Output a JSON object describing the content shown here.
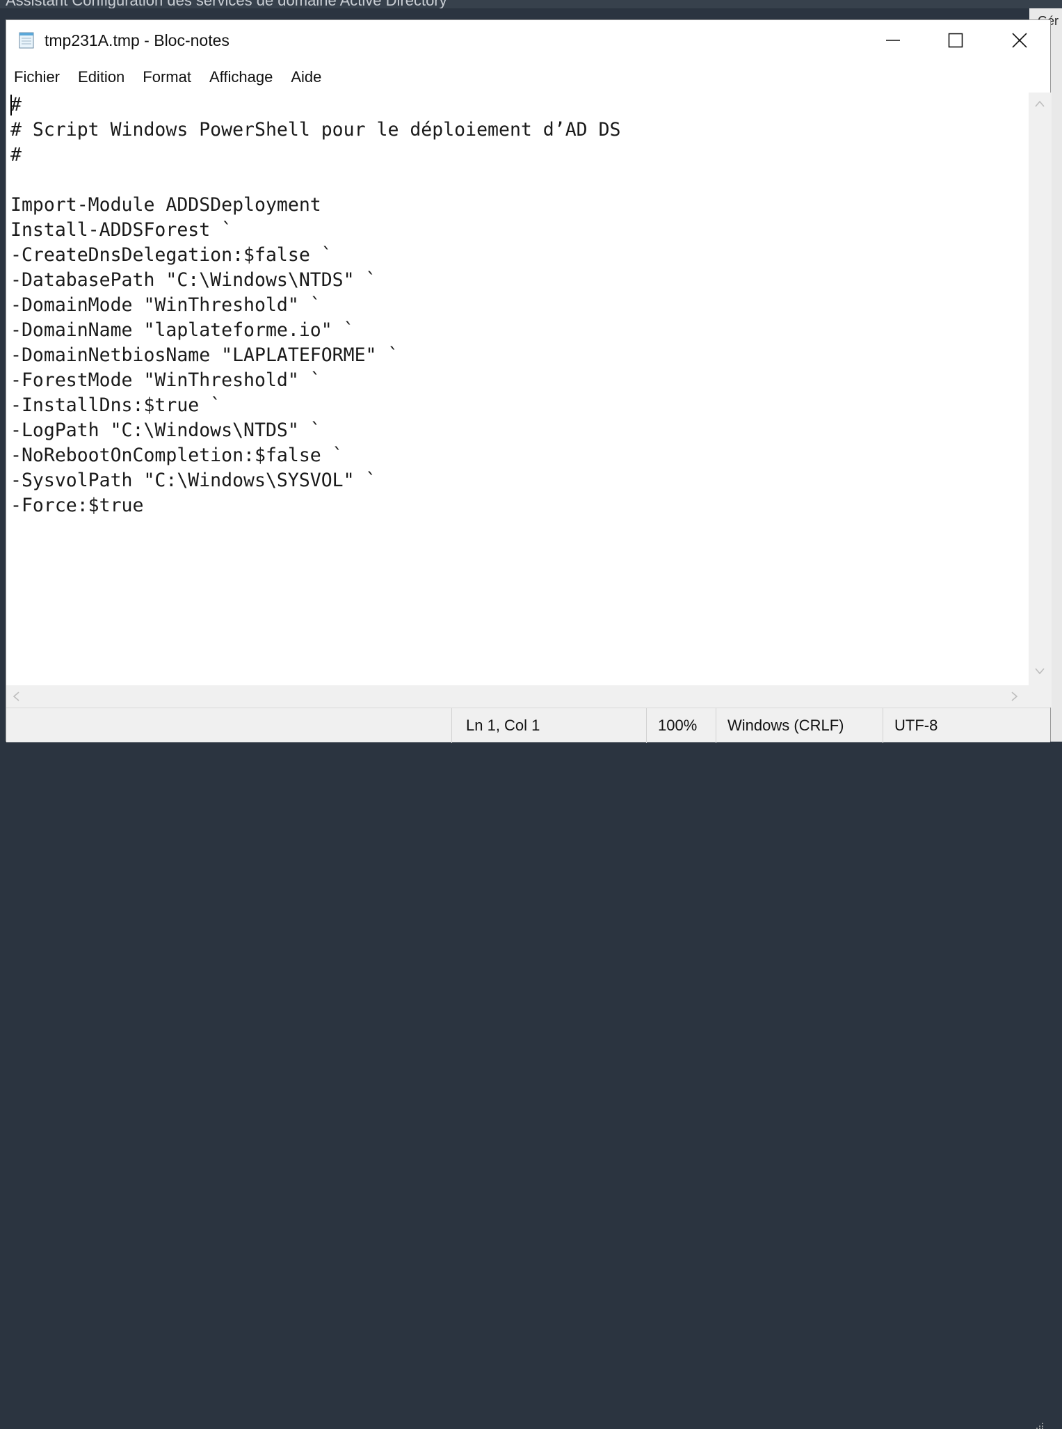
{
  "background": {
    "title": "Assistant Configuration des services de domaine Active Directory",
    "peek_text": "Gér"
  },
  "window": {
    "title": "tmp231A.tmp - Bloc-notes",
    "icon": "notepad-icon",
    "controls": {
      "minimize": "minimize-icon",
      "maximize": "maximize-icon",
      "close": "close-icon"
    }
  },
  "menu": {
    "items": [
      {
        "label": "Fichier"
      },
      {
        "label": "Edition"
      },
      {
        "label": "Format"
      },
      {
        "label": "Affichage"
      },
      {
        "label": "Aide"
      }
    ]
  },
  "editor": {
    "lines": [
      "#",
      "# Script Windows PowerShell pour le déploiement d’AD DS",
      "#",
      "",
      "Import-Module ADDSDeployment",
      "Install-ADDSForest `",
      "-CreateDnsDelegation:$false `",
      "-DatabasePath \"C:\\Windows\\NTDS\" `",
      "-DomainMode \"WinThreshold\" `",
      "-DomainName \"laplateforme.io\" `",
      "-DomainNetbiosName \"LAPLATEFORME\" `",
      "-ForestMode \"WinThreshold\" `",
      "-InstallDns:$true `",
      "-LogPath \"C:\\Windows\\NTDS\" `",
      "-NoRebootOnCompletion:$false `",
      "-SysvolPath \"C:\\Windows\\SYSVOL\" `",
      "-Force:$true"
    ]
  },
  "status": {
    "position": "Ln 1, Col 1",
    "zoom": "100%",
    "line_ending": "Windows (CRLF)",
    "encoding": "UTF-8"
  },
  "colors": {
    "desktop": "#2b3440",
    "chrome": "#f0f0f0",
    "text": "#111111"
  }
}
